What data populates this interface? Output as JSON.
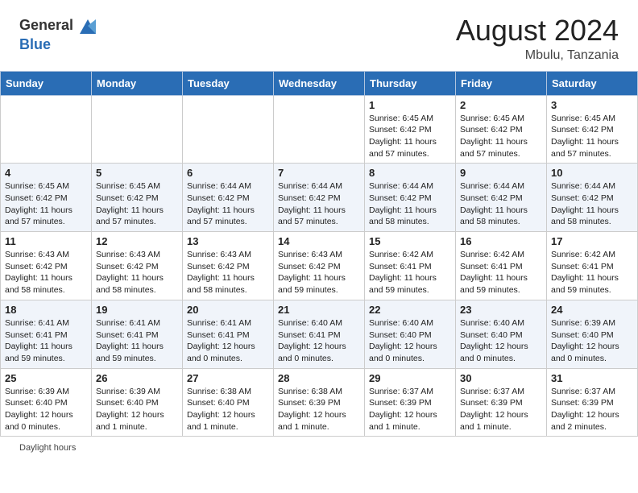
{
  "header": {
    "logo_general": "General",
    "logo_blue": "Blue",
    "month_year": "August 2024",
    "location": "Mbulu, Tanzania"
  },
  "days_of_week": [
    "Sunday",
    "Monday",
    "Tuesday",
    "Wednesday",
    "Thursday",
    "Friday",
    "Saturday"
  ],
  "weeks": [
    [
      {
        "day": "",
        "info": ""
      },
      {
        "day": "",
        "info": ""
      },
      {
        "day": "",
        "info": ""
      },
      {
        "day": "",
        "info": ""
      },
      {
        "day": "1",
        "info": "Sunrise: 6:45 AM\nSunset: 6:42 PM\nDaylight: 11 hours\nand 57 minutes."
      },
      {
        "day": "2",
        "info": "Sunrise: 6:45 AM\nSunset: 6:42 PM\nDaylight: 11 hours\nand 57 minutes."
      },
      {
        "day": "3",
        "info": "Sunrise: 6:45 AM\nSunset: 6:42 PM\nDaylight: 11 hours\nand 57 minutes."
      }
    ],
    [
      {
        "day": "4",
        "info": "Sunrise: 6:45 AM\nSunset: 6:42 PM\nDaylight: 11 hours\nand 57 minutes."
      },
      {
        "day": "5",
        "info": "Sunrise: 6:45 AM\nSunset: 6:42 PM\nDaylight: 11 hours\nand 57 minutes."
      },
      {
        "day": "6",
        "info": "Sunrise: 6:44 AM\nSunset: 6:42 PM\nDaylight: 11 hours\nand 57 minutes."
      },
      {
        "day": "7",
        "info": "Sunrise: 6:44 AM\nSunset: 6:42 PM\nDaylight: 11 hours\nand 57 minutes."
      },
      {
        "day": "8",
        "info": "Sunrise: 6:44 AM\nSunset: 6:42 PM\nDaylight: 11 hours\nand 58 minutes."
      },
      {
        "day": "9",
        "info": "Sunrise: 6:44 AM\nSunset: 6:42 PM\nDaylight: 11 hours\nand 58 minutes."
      },
      {
        "day": "10",
        "info": "Sunrise: 6:44 AM\nSunset: 6:42 PM\nDaylight: 11 hours\nand 58 minutes."
      }
    ],
    [
      {
        "day": "11",
        "info": "Sunrise: 6:43 AM\nSunset: 6:42 PM\nDaylight: 11 hours\nand 58 minutes."
      },
      {
        "day": "12",
        "info": "Sunrise: 6:43 AM\nSunset: 6:42 PM\nDaylight: 11 hours\nand 58 minutes."
      },
      {
        "day": "13",
        "info": "Sunrise: 6:43 AM\nSunset: 6:42 PM\nDaylight: 11 hours\nand 58 minutes."
      },
      {
        "day": "14",
        "info": "Sunrise: 6:43 AM\nSunset: 6:42 PM\nDaylight: 11 hours\nand 59 minutes."
      },
      {
        "day": "15",
        "info": "Sunrise: 6:42 AM\nSunset: 6:41 PM\nDaylight: 11 hours\nand 59 minutes."
      },
      {
        "day": "16",
        "info": "Sunrise: 6:42 AM\nSunset: 6:41 PM\nDaylight: 11 hours\nand 59 minutes."
      },
      {
        "day": "17",
        "info": "Sunrise: 6:42 AM\nSunset: 6:41 PM\nDaylight: 11 hours\nand 59 minutes."
      }
    ],
    [
      {
        "day": "18",
        "info": "Sunrise: 6:41 AM\nSunset: 6:41 PM\nDaylight: 11 hours\nand 59 minutes."
      },
      {
        "day": "19",
        "info": "Sunrise: 6:41 AM\nSunset: 6:41 PM\nDaylight: 11 hours\nand 59 minutes."
      },
      {
        "day": "20",
        "info": "Sunrise: 6:41 AM\nSunset: 6:41 PM\nDaylight: 12 hours\nand 0 minutes."
      },
      {
        "day": "21",
        "info": "Sunrise: 6:40 AM\nSunset: 6:41 PM\nDaylight: 12 hours\nand 0 minutes."
      },
      {
        "day": "22",
        "info": "Sunrise: 6:40 AM\nSunset: 6:40 PM\nDaylight: 12 hours\nand 0 minutes."
      },
      {
        "day": "23",
        "info": "Sunrise: 6:40 AM\nSunset: 6:40 PM\nDaylight: 12 hours\nand 0 minutes."
      },
      {
        "day": "24",
        "info": "Sunrise: 6:39 AM\nSunset: 6:40 PM\nDaylight: 12 hours\nand 0 minutes."
      }
    ],
    [
      {
        "day": "25",
        "info": "Sunrise: 6:39 AM\nSunset: 6:40 PM\nDaylight: 12 hours\nand 0 minutes."
      },
      {
        "day": "26",
        "info": "Sunrise: 6:39 AM\nSunset: 6:40 PM\nDaylight: 12 hours\nand 1 minute."
      },
      {
        "day": "27",
        "info": "Sunrise: 6:38 AM\nSunset: 6:40 PM\nDaylight: 12 hours\nand 1 minute."
      },
      {
        "day": "28",
        "info": "Sunrise: 6:38 AM\nSunset: 6:39 PM\nDaylight: 12 hours\nand 1 minute."
      },
      {
        "day": "29",
        "info": "Sunrise: 6:37 AM\nSunset: 6:39 PM\nDaylight: 12 hours\nand 1 minute."
      },
      {
        "day": "30",
        "info": "Sunrise: 6:37 AM\nSunset: 6:39 PM\nDaylight: 12 hours\nand 1 minute."
      },
      {
        "day": "31",
        "info": "Sunrise: 6:37 AM\nSunset: 6:39 PM\nDaylight: 12 hours\nand 2 minutes."
      }
    ]
  ],
  "footer": {
    "daylight_label": "Daylight hours"
  }
}
